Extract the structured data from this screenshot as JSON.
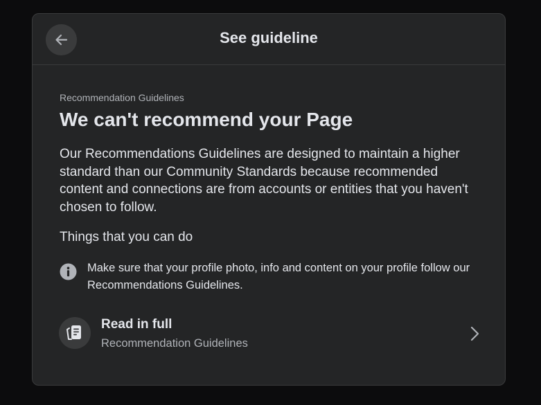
{
  "header": {
    "title": "See guideline",
    "back_icon": "arrow-left-icon"
  },
  "content": {
    "eyebrow": "Recommendation Guidelines",
    "headline": "We can't recommend your Page",
    "body": "Our Recommendations Guidelines are designed to maintain a higher standard than our Community Standards because recommended content and connections are from accounts or entities that you haven't chosen to follow.",
    "things_heading": "Things that you can do",
    "info_text": "Make sure that your profile photo, info and content on your profile follow our Recommendations Guidelines."
  },
  "read_full": {
    "title": "Read in full",
    "subtitle": "Recommendation Guidelines",
    "icon": "document-icon",
    "chevron_icon": "chevron-right-icon"
  },
  "colors": {
    "background": "#0c0c0d",
    "dialog": "#242526",
    "button_bg": "#3a3b3c",
    "primary_text": "#e4e6eb",
    "secondary_text": "#b0b3b8"
  }
}
